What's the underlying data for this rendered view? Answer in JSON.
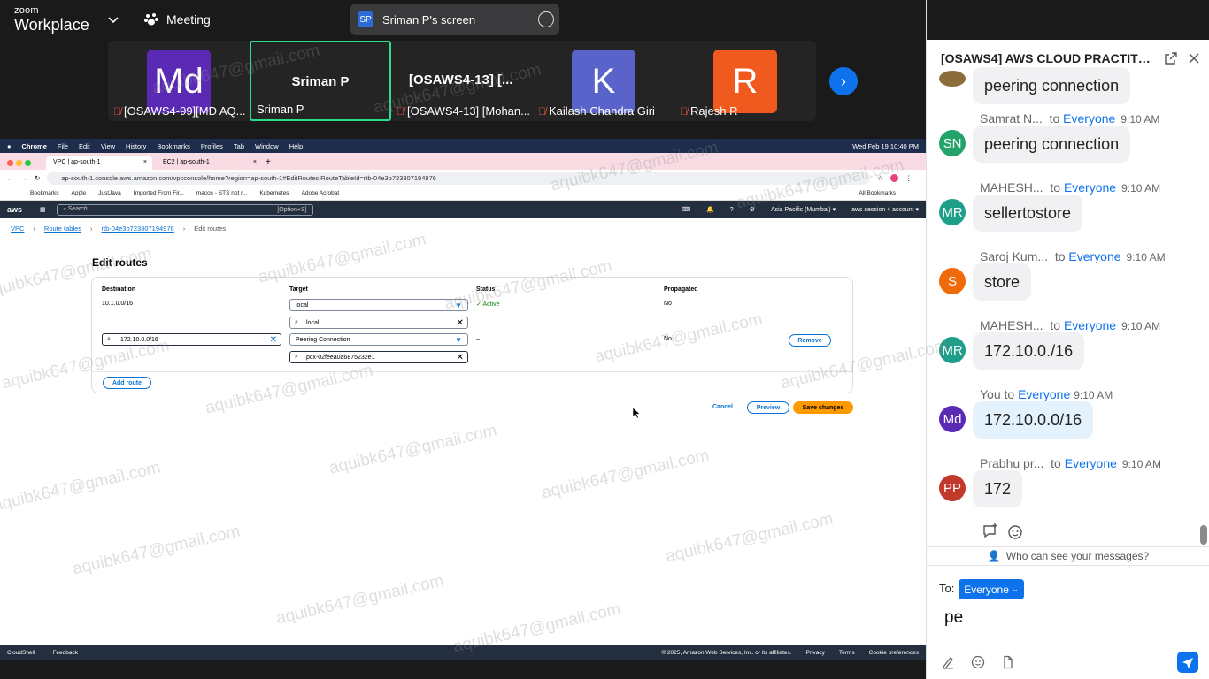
{
  "zoom": {
    "brand_top": "zoom",
    "brand_bottom": "Workplace",
    "meeting_label": "Meeting",
    "share_badge": "SP",
    "share_title": "Sriman P's screen"
  },
  "gallery": {
    "tiles": [
      {
        "initials": "Md",
        "name": "[OSAWS4-99][MD AQ...",
        "color": "#5b2ab5",
        "muted": true
      },
      {
        "big": "Sriman P",
        "name": "Sriman P",
        "muted": false,
        "active": true
      },
      {
        "big": "[OSAWS4-13] [...",
        "name": "[OSAWS4-13] [Mohan...",
        "muted": true
      },
      {
        "initials": "K",
        "name": "Kailash Chandra Giri",
        "color": "#5a63c9",
        "muted": true
      },
      {
        "initials": "R",
        "name": "Rajesh R",
        "color": "#f05a1e",
        "muted": true
      }
    ]
  },
  "mac": {
    "items": [
      "Chrome",
      "File",
      "Edit",
      "View",
      "History",
      "Bookmarks",
      "Profiles",
      "Tab",
      "Window",
      "Help"
    ],
    "clock": "Wed Feb 19  10:40 PM"
  },
  "browser": {
    "tabs": [
      "VPC | ap-south-1",
      "EC2 | ap-south-1"
    ],
    "url": "ap-south-1.console.aws.amazon.com/vpcconsole/home?region=ap-south-1#EditRoutes:RouteTableId=rtb-04e3b723307194976",
    "bookmarks": [
      "Bookmarks",
      "Apple",
      "JustJava",
      "Imported From Fir...",
      "macos - STS not r...",
      "Kubernetes",
      "Adobe Acrobat"
    ],
    "all_bookmarks": "All Bookmarks"
  },
  "aws": {
    "logo": "aws",
    "search_placeholder": "Search",
    "search_shortcut": "[Option+S]",
    "region": "Asia Pacific (Mumbai) ▾",
    "account": "aws session 4 account ▾",
    "breadcrumb": [
      "VPC",
      "Route tables",
      "rtb-04e3b723307194976",
      "Edit routes"
    ],
    "page_title": "Edit routes",
    "columns": [
      "Destination",
      "Target",
      "Status",
      "Propagated"
    ],
    "route1": {
      "destination": "10.1.0.0/16",
      "target": "local",
      "target_search": "local",
      "status": "Active",
      "propagated": "No"
    },
    "route2": {
      "destination": "172.10.0.0/16",
      "target": "Peering Connection",
      "target_search": "pcx-02feea0a6875232e1",
      "status": "–",
      "propagated": "No",
      "remove": "Remove"
    },
    "add_route": "Add route",
    "cancel": "Cancel",
    "preview": "Preview",
    "save": "Save changes",
    "footer_left": [
      "CloudShell",
      "Feedback"
    ],
    "footer_right": [
      "© 2025, Amazon Web Services, Inc. or its affiliates.",
      "Privacy",
      "Terms",
      "Cookie preferences"
    ]
  },
  "watermark": "aquibk647@gmail.com",
  "chat": {
    "title": "[OSAWS4] AWS CLOUD PRACTITION...",
    "partial_message": "peering connection",
    "messages": [
      {
        "sender": "Samrat N...",
        "to": "to",
        "audience": "Everyone",
        "time": "9:10 AM",
        "text": "peering connection",
        "avatar": "SN",
        "color": "#23a36a"
      },
      {
        "sender": "MAHESH...",
        "to": "to",
        "audience": "Everyone",
        "time": "9:10 AM",
        "text": "sellertostore",
        "avatar": "MR",
        "color": "#1f9e8a"
      },
      {
        "sender": "Saroj Kum...",
        "to": "to",
        "audience": "Everyone",
        "time": "9:10 AM",
        "text": "store",
        "avatar": "S",
        "color": "#f06a0a"
      },
      {
        "sender": "MAHESH...",
        "to": "to",
        "audience": "Everyone",
        "time": "9:10 AM",
        "text": "172.10.0./16",
        "avatar": "MR",
        "color": "#1f9e8a"
      },
      {
        "sender": "You",
        "to": "to",
        "audience": "Everyone",
        "time": "9:10 AM",
        "text": "172.10.0.0/16",
        "avatar": "Md",
        "color": "#5b2ab5",
        "me": true
      },
      {
        "sender": "Prabhu pr...",
        "to": "to",
        "audience": "Everyone",
        "time": "9:10 AM",
        "text": "172",
        "avatar": "PP",
        "color": "#c0392b"
      }
    ],
    "who_can_see": "Who can see your messages?",
    "to_label": "To:",
    "recipient": "Everyone",
    "draft": "pe"
  }
}
